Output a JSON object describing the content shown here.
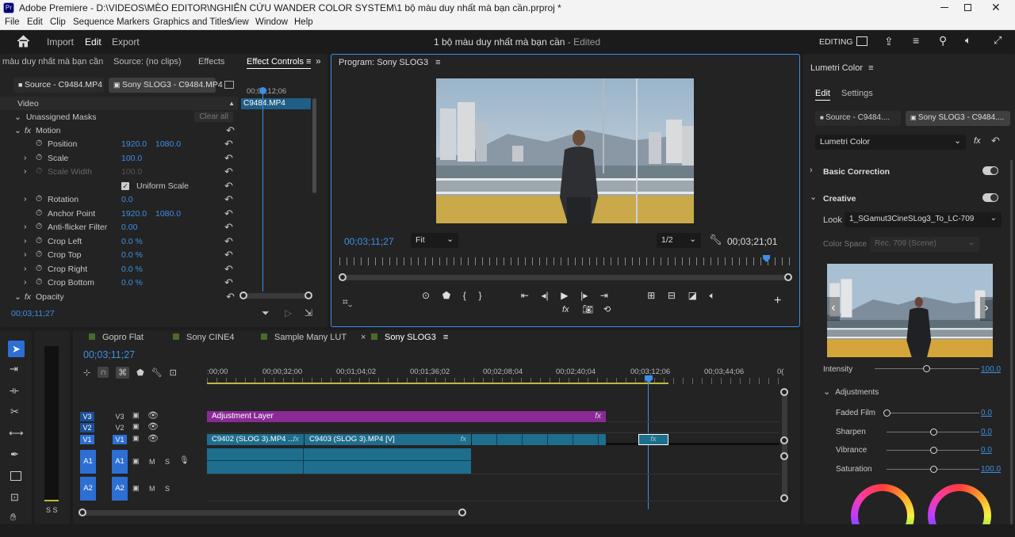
{
  "title_bar": {
    "title": "Adobe Premiere - D:\\VIDEOS\\MÈO EDITOR\\NGHIÊN CỨU WANDER COLOR SYSTEM\\1 bộ màu duy nhất mà bạn cần.prproj *"
  },
  "menu": [
    "File",
    "Edit",
    "Clip",
    "Sequence",
    "Markers",
    "Graphics and Titles",
    "View",
    "Window",
    "Help"
  ],
  "header": {
    "tabs": [
      "Import",
      "Edit",
      "Export"
    ],
    "project_title": "1 bộ màu duy nhất mà bạn cần",
    "status": " - Edited",
    "workspace": "EDITING"
  },
  "effect_panel": {
    "tabs": [
      "màu duy nhất mà bạn cần",
      "Source: (no clips)",
      "Effects",
      "Effect Controls"
    ],
    "source_btn": "Source - C9484.MP4",
    "seq_btn": "Sony SLOG3 - C9484.MP4",
    "timecode_top": "00;03;12;06",
    "clip_name": "C9484.MP4",
    "video_label": "Video",
    "unassigned_masks": "Unassigned Masks",
    "clear_all": "Clear all",
    "motion": "Motion",
    "props": [
      {
        "name": "Position",
        "v1": "1920.0",
        "v2": "1080.0"
      },
      {
        "name": "Scale",
        "v1": "100.0",
        "v2": ""
      },
      {
        "name": "Scale Width",
        "v1": "100.0",
        "v2": ""
      },
      {
        "name": "Uniform Scale",
        "v1": "",
        "v2": ""
      },
      {
        "name": "Rotation",
        "v1": "0.0",
        "v2": ""
      },
      {
        "name": "Anchor Point",
        "v1": "1920.0",
        "v2": "1080.0"
      },
      {
        "name": "Anti-flicker Filter",
        "v1": "0.00",
        "v2": ""
      },
      {
        "name": "Crop Left",
        "v1": "0.0 %",
        "v2": ""
      },
      {
        "name": "Crop Top",
        "v1": "0.0 %",
        "v2": ""
      },
      {
        "name": "Crop Right",
        "v1": "0.0 %",
        "v2": ""
      },
      {
        "name": "Crop Bottom",
        "v1": "0.0 %",
        "v2": ""
      }
    ],
    "opacity": "Opacity",
    "timecode_bottom": "00;03;11;27"
  },
  "program": {
    "title": "Program: Sony SLOG3",
    "timecode_left": "00;03;11;27",
    "fit": "Fit",
    "resolution": "1/2",
    "timecode_right": "00;03;21;01"
  },
  "timeline": {
    "tabs": [
      "Gopro Flat",
      "Sony CINE4",
      "Sample Many LUT",
      "Sony SLOG3"
    ],
    "timecode": "00;03;11;27",
    "ruler": [
      ":00;00",
      "00;00;32;00",
      "00;01;04;02",
      "00;01;36;02",
      "00;02;08;04",
      "00;02;40;04",
      "00;03;12;06",
      "00;03;44;06",
      "0("
    ],
    "tracks_v": [
      "V3",
      "V2",
      "V1"
    ],
    "tracks_a": [
      "A1",
      "A2"
    ],
    "clip_adjustment": "Adjustment Layer",
    "clip_v1a": "C9402 (SLOG 3).MP4 ...",
    "clip_v1b": "C9403 (SLOG 3).MP4 [V]",
    "fx": "fx",
    "m": "M",
    "s": "S",
    "meter": "S S"
  },
  "lumetri": {
    "title": "Lumetri Color",
    "tabs": [
      "Edit",
      "Settings"
    ],
    "source_btn": "Source - C9484....",
    "seq_btn": "Sony SLOG3 - C9484....",
    "effect": "Lumetri Color",
    "basic_correction": "Basic Correction",
    "creative": "Creative",
    "look_label": "Look",
    "look_value": "1_SGamut3CineSLog3_To_LC-709",
    "color_space_label": "Color Space",
    "color_space_value": "Rec. 709 (Scene)",
    "intensity_label": "Intensity",
    "intensity_value": "100.0",
    "adjustments": "Adjustments",
    "sliders": [
      {
        "label": "Faded Film",
        "value": "0.0",
        "pos": 0
      },
      {
        "label": "Sharpen",
        "value": "0.0",
        "pos": 0.5
      },
      {
        "label": "Vibrance",
        "value": "0.0",
        "pos": 0.5
      },
      {
        "label": "Saturation",
        "value": "100.0",
        "pos": 0.5
      }
    ]
  }
}
